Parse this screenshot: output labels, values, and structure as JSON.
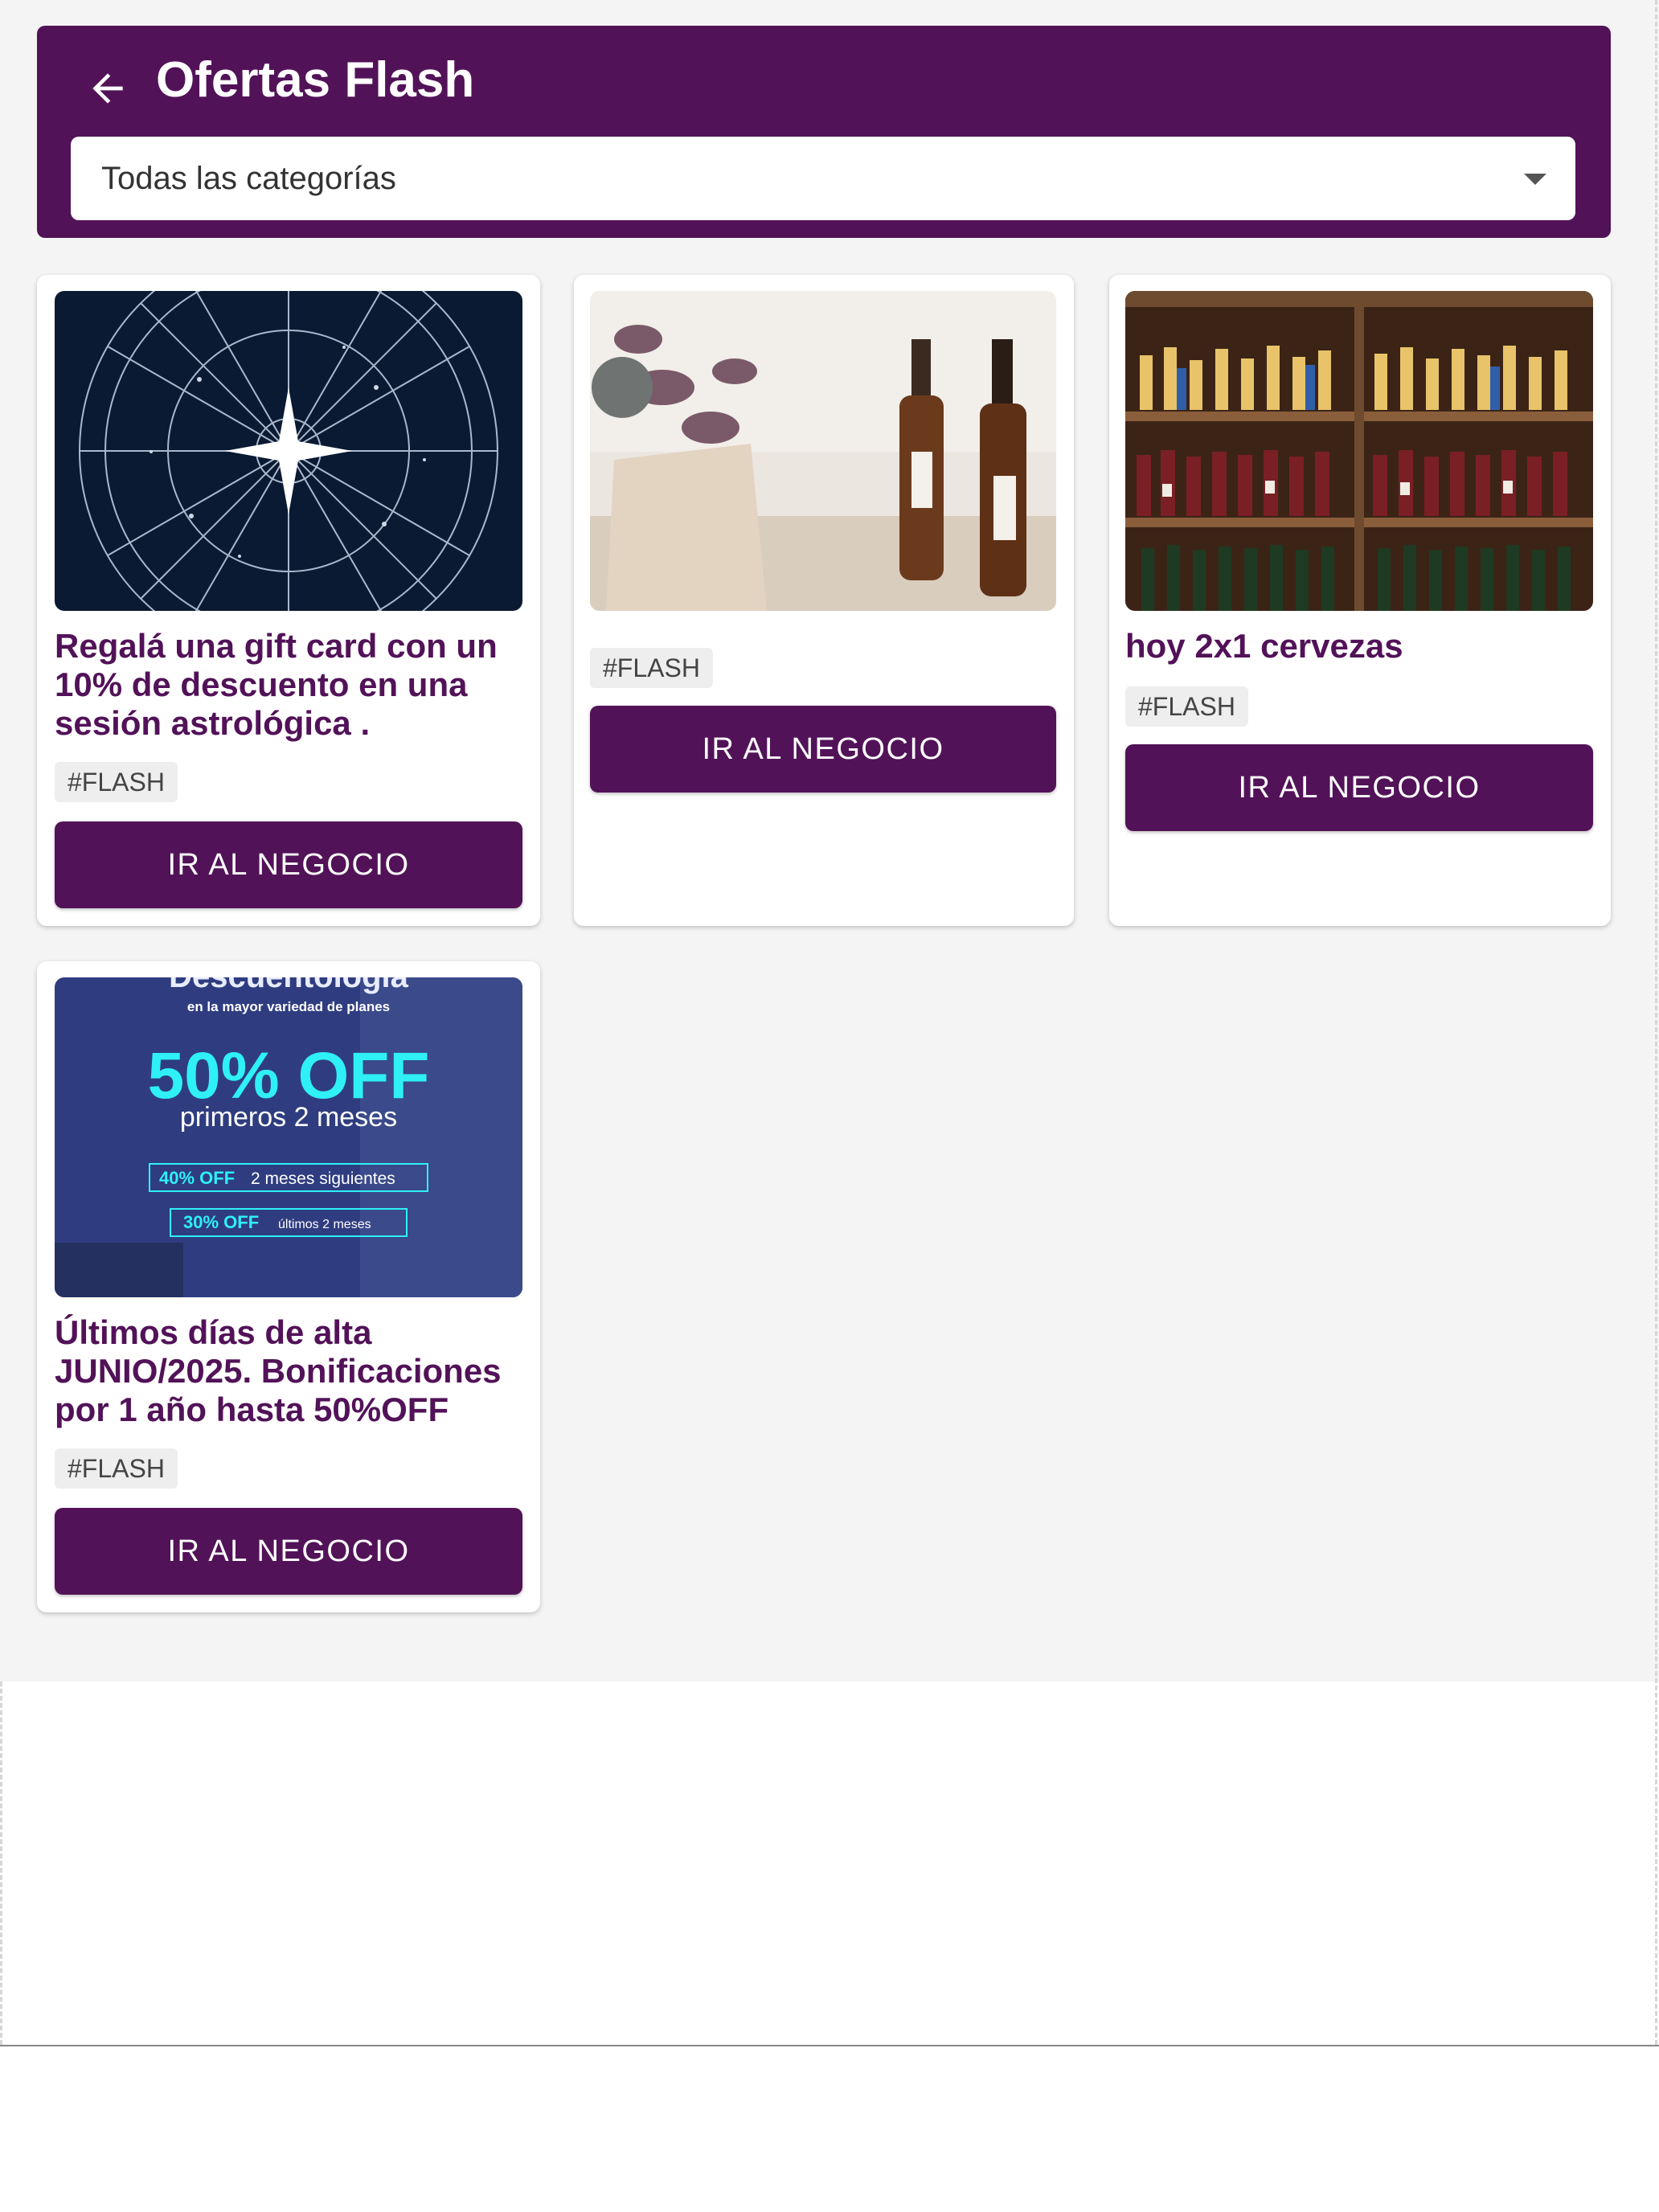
{
  "header": {
    "title": "Ofertas Flash",
    "back_icon": "arrow-left-icon",
    "background_color": "#521258"
  },
  "category_filter": {
    "selected": "Todas las categorías",
    "icon": "caret-down-icon"
  },
  "cards": [
    {
      "title": "Regalá una gift card con un 10% de descuento en una sesión astrológica .",
      "tag": "#FLASH",
      "button": "IR AL NEGOCIO",
      "image": "zodiac-wheel-image"
    },
    {
      "title": "",
      "tag": "#FLASH",
      "button": "IR AL NEGOCIO",
      "image": "oil-bottles-image"
    },
    {
      "title": "hoy 2x1 cervezas",
      "tag": "#FLASH",
      "button": "IR AL NEGOCIO",
      "image": "liquor-shelves-image"
    },
    {
      "title": "Últimos días de alta JUNIO/2025. Bonificaciones por 1 año hasta 50%OFF",
      "tag": "#FLASH",
      "button": "IR AL NEGOCIO",
      "image": "promo-banner-image",
      "image_text": {
        "brand": "Descuentologia",
        "tagline": "en la mayor variedad de planes",
        "offer": "50% OFF",
        "offer_detail": "primeros 2 meses",
        "offer2": "40% OFF",
        "offer2_detail": "2 meses siguientes",
        "offer3": "30% OFF",
        "offer3_detail": "últimos 2 meses"
      }
    }
  ],
  "colors": {
    "accent": "#521258",
    "page_background": "#f4f4f4",
    "tag_background": "#eeeeee"
  }
}
